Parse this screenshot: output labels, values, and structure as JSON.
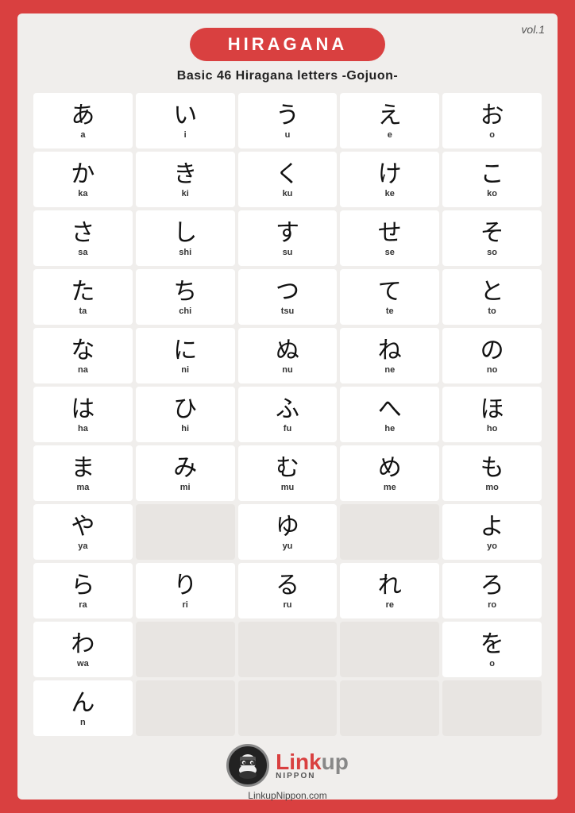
{
  "header": {
    "vol": "vol.1",
    "title": "HIRAGANA",
    "subtitle": "Basic 46 Hiragana letters -Gojuon-"
  },
  "rows": [
    [
      {
        "kana": "あ",
        "romaji": "a"
      },
      {
        "kana": "い",
        "romaji": "i"
      },
      {
        "kana": "う",
        "romaji": "u"
      },
      {
        "kana": "え",
        "romaji": "e"
      },
      {
        "kana": "お",
        "romaji": "o"
      }
    ],
    [
      {
        "kana": "か",
        "romaji": "ka"
      },
      {
        "kana": "き",
        "romaji": "ki"
      },
      {
        "kana": "く",
        "romaji": "ku"
      },
      {
        "kana": "け",
        "romaji": "ke"
      },
      {
        "kana": "こ",
        "romaji": "ko"
      }
    ],
    [
      {
        "kana": "さ",
        "romaji": "sa"
      },
      {
        "kana": "し",
        "romaji": "shi"
      },
      {
        "kana": "す",
        "romaji": "su"
      },
      {
        "kana": "せ",
        "romaji": "se"
      },
      {
        "kana": "そ",
        "romaji": "so"
      }
    ],
    [
      {
        "kana": "た",
        "romaji": "ta"
      },
      {
        "kana": "ち",
        "romaji": "chi"
      },
      {
        "kana": "つ",
        "romaji": "tsu"
      },
      {
        "kana": "て",
        "romaji": "te"
      },
      {
        "kana": "と",
        "romaji": "to"
      }
    ],
    [
      {
        "kana": "な",
        "romaji": "na"
      },
      {
        "kana": "に",
        "romaji": "ni"
      },
      {
        "kana": "ぬ",
        "romaji": "nu"
      },
      {
        "kana": "ね",
        "romaji": "ne"
      },
      {
        "kana": "の",
        "romaji": "no"
      }
    ],
    [
      {
        "kana": "は",
        "romaji": "ha"
      },
      {
        "kana": "ひ",
        "romaji": "hi"
      },
      {
        "kana": "ふ",
        "romaji": "fu"
      },
      {
        "kana": "へ",
        "romaji": "he"
      },
      {
        "kana": "ほ",
        "romaji": "ho"
      }
    ],
    [
      {
        "kana": "ま",
        "romaji": "ma"
      },
      {
        "kana": "み",
        "romaji": "mi"
      },
      {
        "kana": "む",
        "romaji": "mu"
      },
      {
        "kana": "め",
        "romaji": "me"
      },
      {
        "kana": "も",
        "romaji": "mo"
      }
    ],
    [
      {
        "kana": "や",
        "romaji": "ya"
      },
      {
        "kana": "",
        "romaji": ""
      },
      {
        "kana": "ゆ",
        "romaji": "yu"
      },
      {
        "kana": "",
        "romaji": ""
      },
      {
        "kana": "よ",
        "romaji": "yo"
      }
    ],
    [
      {
        "kana": "ら",
        "romaji": "ra"
      },
      {
        "kana": "り",
        "romaji": "ri"
      },
      {
        "kana": "る",
        "romaji": "ru"
      },
      {
        "kana": "れ",
        "romaji": "re"
      },
      {
        "kana": "ろ",
        "romaji": "ro"
      }
    ],
    [
      {
        "kana": "わ",
        "romaji": "wa"
      },
      {
        "kana": "",
        "romaji": ""
      },
      {
        "kana": "",
        "romaji": ""
      },
      {
        "kana": "",
        "romaji": ""
      },
      {
        "kana": "を",
        "romaji": "o"
      }
    ],
    [
      {
        "kana": "ん",
        "romaji": "n"
      },
      {
        "kana": "",
        "romaji": ""
      },
      {
        "kana": "",
        "romaji": ""
      },
      {
        "kana": "",
        "romaji": ""
      },
      {
        "kana": "",
        "romaji": ""
      }
    ]
  ],
  "footer": {
    "website": "LinkupNippon.com",
    "nippon": "NIPPON"
  }
}
